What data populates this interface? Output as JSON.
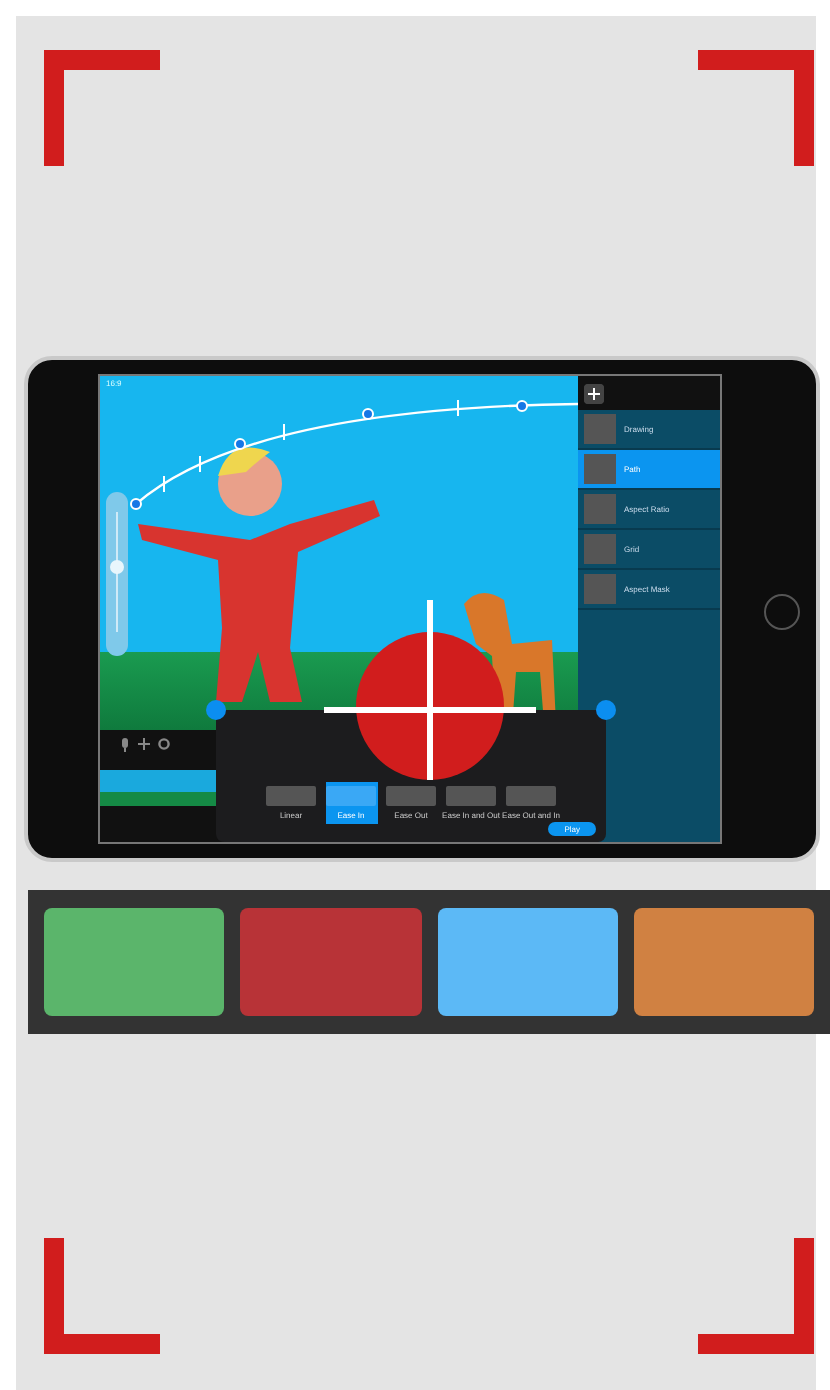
{
  "tablet": {
    "status_time": "16:9",
    "zoom_slider": {
      "level": 0.55
    },
    "layers": [
      {
        "name": "Drawing",
        "selected": false
      },
      {
        "name": "Path",
        "selected": true
      },
      {
        "name": "Aspect Ratio",
        "selected": false
      },
      {
        "name": "Grid",
        "selected": false
      },
      {
        "name": "Aspect Mask",
        "selected": false
      }
    ],
    "easing": {
      "options": [
        {
          "label": "Linear",
          "selected": false
        },
        {
          "label": "Ease In",
          "selected": true
        },
        {
          "label": "Ease Out",
          "selected": false
        },
        {
          "label": "Ease In and Out",
          "selected": false
        },
        {
          "label": "Ease Out and In",
          "selected": false
        }
      ],
      "play": "Play"
    }
  },
  "swatches": [
    {
      "color": "#5bb56b"
    },
    {
      "color": "#b83337"
    },
    {
      "color": "#5cb9f6"
    },
    {
      "color": "#d08142"
    }
  ]
}
